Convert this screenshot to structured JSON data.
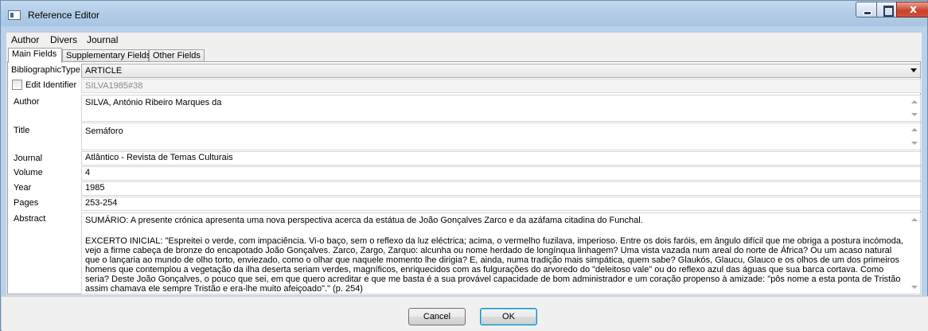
{
  "window": {
    "title": "Reference Editor"
  },
  "menu": [
    "Author",
    "Divers",
    "Journal"
  ],
  "tabs": [
    "Main Fields",
    "Supplementary Fields",
    "Other Fields"
  ],
  "fields": {
    "bibliographic_type": {
      "label": "BibliographicType",
      "value": "ARTICLE"
    },
    "identifier": {
      "label": "Edit Identifier",
      "value": "SILVA1985#38",
      "checked": false
    },
    "author": {
      "label": "Author",
      "value": "SILVA, António Ribeiro Marques da"
    },
    "title": {
      "label": "Title",
      "value": "Semáforo"
    },
    "journal": {
      "label": "Journal",
      "value": "Atlântico - Revista de Temas Culturais"
    },
    "volume": {
      "label": "Volume",
      "value": "4"
    },
    "year": {
      "label": "Year",
      "value": "1985"
    },
    "pages": {
      "label": "Pages",
      "value": "253-254"
    },
    "abstract": {
      "label": "Abstract",
      "summary": "SUMÁRIO: A presente crónica apresenta uma nova perspectiva acerca da estátua de João Gonçalves Zarco e da azáfama citadina do Funchal.",
      "excerpt": "EXCERTO INICIAL: \"Espreitei o verde, com impaciência. Vi-o baço, sem o reflexo da luz eléctrica; acima, o vermelho fuzilava, imperioso. Entre os dois faróis, em ângulo difícil que me obriga a postura incómoda, vejo a firme cabeça de bronze do encapotado João Gonçalves. Zarco, Zargo, Zarquo: alcunha ou nome herdado de longínqua linhagem? Uma vista vazada num areal do norte de África? Ou um acaso natural que o lançaria ao mundo de olho torto, enviezado, como o olhar que naquele momento lhe dirigia? E, ainda, numa tradição mais simpática, quem sabe? Glaukós, Glaucu, Glauco e os olhos de um dos primeiros homens que contemplou a vegetação da ilha deserta seriam verdes, magníficos, enriquecidos com as fulgurações do arvoredo do \"deleitoso vale\" ou do reflexo azul das águas que sua barca cortava. Como seria? Deste João Gonçalves, o pouco que sei, em que quero acreditar e que me basta é a sua provável capacidade de bom administrador e um coração propenso à amizade: \"pôs nome a esta ponta de Tristão assim chamava ele sempre Tristão e era-lhe muito afeiçoado\".\" (p. 254)"
    }
  },
  "buttons": {
    "cancel": "Cancel",
    "ok": "OK"
  },
  "icons": {
    "app": "window-icon",
    "minimize": "minimize-icon",
    "maximize": "maximize-icon",
    "close": "close-icon"
  },
  "colors": {
    "frame": "#b9d1ea",
    "panel": "#ffffff",
    "default_button_border": "#3c7fb1"
  }
}
